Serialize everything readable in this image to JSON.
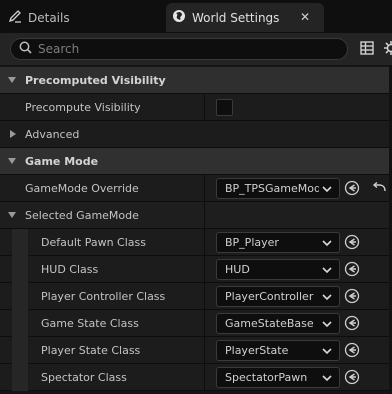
{
  "tabs": {
    "details": {
      "label": "Details",
      "icon": "pencil-icon"
    },
    "world_settings": {
      "label": "World Settings",
      "icon": "globe-icon",
      "close_glyph": "✕"
    }
  },
  "toolbar": {
    "search_placeholder": "Search",
    "search_value": "",
    "view_options_icon": "table-icon",
    "settings_icon": "gear-icon"
  },
  "sections": {
    "precomputed_visibility": {
      "title": "Precomputed Visibility",
      "expanded": true,
      "precompute_visibility": {
        "label": "Precompute Visibility",
        "checked": false
      },
      "advanced": {
        "label": "Advanced",
        "expanded": false
      }
    },
    "game_mode": {
      "title": "Game Mode",
      "expanded": true,
      "gamemode_override": {
        "label": "GameMode Override",
        "value": "BP_TPSGameMode"
      },
      "selected_gamemode": {
        "label": "Selected GameMode",
        "expanded": true,
        "properties": [
          {
            "label": "Default Pawn Class",
            "value": "BP_Player"
          },
          {
            "label": "HUD Class",
            "value": "HUD"
          },
          {
            "label": "Player Controller Class",
            "value": "PlayerController"
          },
          {
            "label": "Game State Class",
            "value": "GameStateBase"
          },
          {
            "label": "Player State Class",
            "value": "PlayerState"
          },
          {
            "label": "Spectator Class",
            "value": "SpectatorPawn"
          }
        ]
      }
    }
  },
  "colors": {
    "panel_bg": "#242424",
    "category_bg": "#2f2f2f",
    "field_bg": "#0e0e0e",
    "text": "#c8c8c8"
  }
}
